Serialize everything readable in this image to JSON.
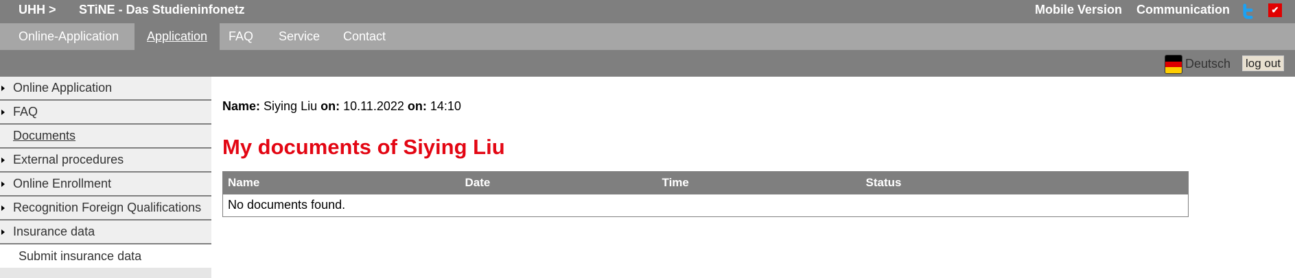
{
  "header": {
    "uhh": "UHH >",
    "site_title": "STiNE - Das Studieninfonetz",
    "mobile_version": "Mobile Version",
    "communication": "Communication",
    "menu_toggle_symbol": "✔"
  },
  "nav": {
    "tabs": [
      {
        "label": "Online-Application"
      },
      {
        "label": "Application"
      },
      {
        "label": "FAQ"
      },
      {
        "label": "Service"
      },
      {
        "label": "Contact"
      }
    ],
    "active": "Application"
  },
  "langbar": {
    "language": "Deutsch",
    "logout": "log out",
    "flag_colors": [
      "#000000",
      "#dd0000",
      "#ffce00"
    ]
  },
  "sidebar": {
    "items": [
      {
        "label": "Online Application"
      },
      {
        "label": "FAQ"
      },
      {
        "label": "Documents"
      },
      {
        "label": "External procedures"
      },
      {
        "label": "Online Enrollment"
      },
      {
        "label": "Recognition Foreign Qualifications"
      },
      {
        "label": "Insurance data"
      }
    ],
    "sub_item": "Submit insurance data"
  },
  "main": {
    "name_label": "Name:",
    "name_value": "Siying Liu",
    "on_label1": "on:",
    "date_value": "10.11.2022",
    "on_label2": "on:",
    "time_value": "14:10",
    "title": "My documents of Siying Liu",
    "table": {
      "columns": [
        "Name",
        "Date",
        "Time",
        "Status"
      ],
      "empty_message": "No documents found."
    }
  },
  "colors": {
    "header_bg": "#7f7f7f",
    "nav_bg": "#a6a6a6",
    "title_red": "#e30613",
    "twitter_blue": "#1da1f2"
  }
}
